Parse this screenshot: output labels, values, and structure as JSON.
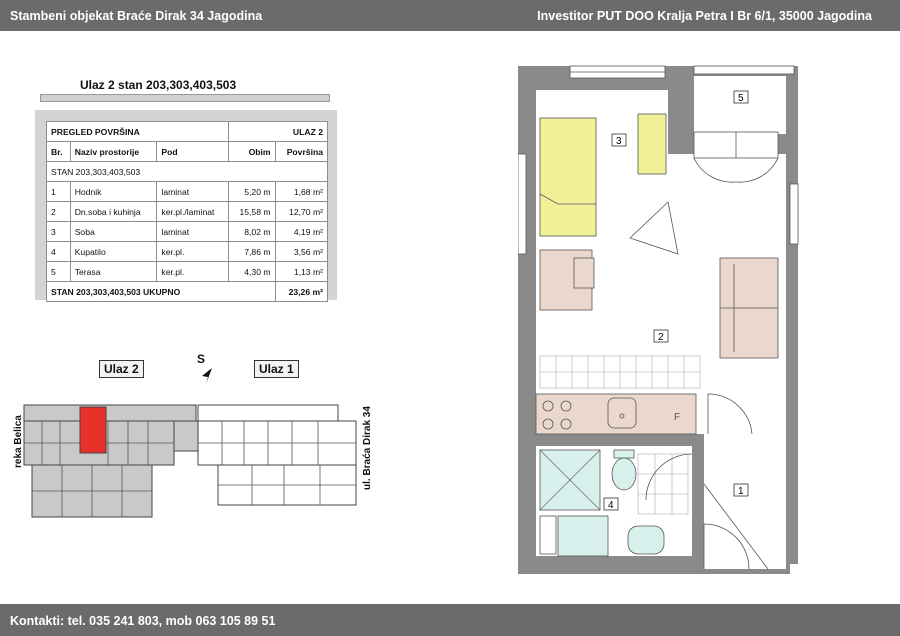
{
  "header": {
    "left": "Stambeni  objekat Braće Dirak 34  Jagodina",
    "right": "Investitor PUT DOO Kralja Petra I Br 6/1, 35000 Jagodina"
  },
  "footer": {
    "contact": "Kontakti: tel. 035 241 803, mob 063 105 89 51"
  },
  "subtitle": "Ulaz 2 stan 203,303,403,503",
  "table": {
    "title": "PREGLED POVRŠINA",
    "entrance": "ULAZ 2",
    "columns": [
      "Br.",
      "Naziv prostorije",
      "Pod",
      "Obim",
      "Površina"
    ],
    "group": "STAN 203,303,403,503",
    "rows": [
      [
        "1",
        "Hodnik",
        "laminat",
        "5,20 m",
        "1,68 m²"
      ],
      [
        "2",
        "Dn.soba i kuhinja",
        "ker.pl./laminat",
        "15,58 m",
        "12,70 m²"
      ],
      [
        "3",
        "Soba",
        "laminat",
        "8,02 m",
        "4,19 m²"
      ],
      [
        "4",
        "Kupatilo",
        "ker.pl.",
        "7,86 m",
        "3,56 m²"
      ],
      [
        "5",
        "Terasa",
        "ker.pl.",
        "4,30 m",
        "1,13 m²"
      ]
    ],
    "total_label": "STAN 203,303,403,503  UKUPNO",
    "total_value": "23,26 m²"
  },
  "siteplan": {
    "entrance2": "Ulaz 2",
    "entrance1": "Ulaz 1",
    "compass": "S",
    "river": "reka Belica",
    "street": "ul. Braća Dirak 34",
    "highlight_color": "#e8312b"
  },
  "floorplan": {
    "room_numbers": [
      "1",
      "2",
      "3",
      "4",
      "5"
    ],
    "bedroom_color": "#f3f09a",
    "furniture_color": "#ead8cc",
    "bath_color": "#d8f0ec",
    "wall_color": "#8a8a8a"
  }
}
